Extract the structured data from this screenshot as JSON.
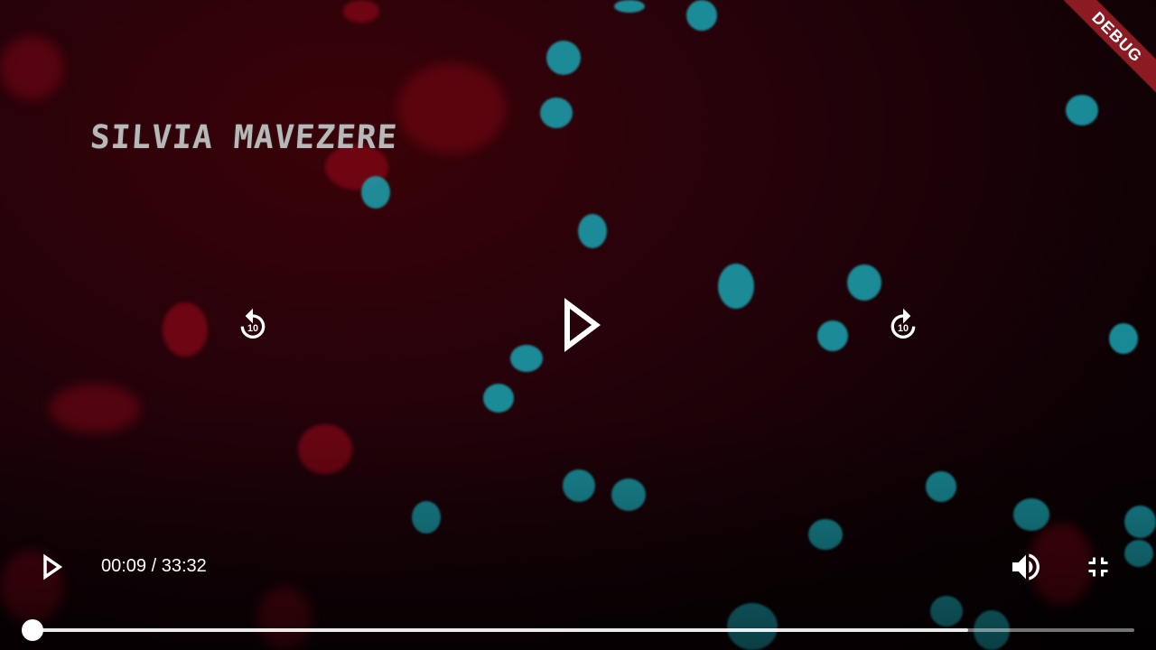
{
  "video": {
    "title_overlay": "SILVIA MAVEZERE",
    "current_time": "00:09",
    "separator": "/",
    "duration": "33:32",
    "time_display": "00:09 / 33:32",
    "progress_fraction": 0.0045,
    "buffered_fraction": 0.85
  },
  "controls": {
    "center_play_icon": "play-icon",
    "rewind_icon": "replay-10-icon",
    "rewind_label": "10",
    "forward_icon": "forward-10-icon",
    "forward_label": "10",
    "bottom_play_icon": "play-icon",
    "volume_icon": "volume-up-icon",
    "fullscreen_icon": "fullscreen-exit-icon"
  },
  "debug_banner": "DEBUG",
  "colors": {
    "accent": "#ffffff",
    "banner": "#8b1a22"
  }
}
